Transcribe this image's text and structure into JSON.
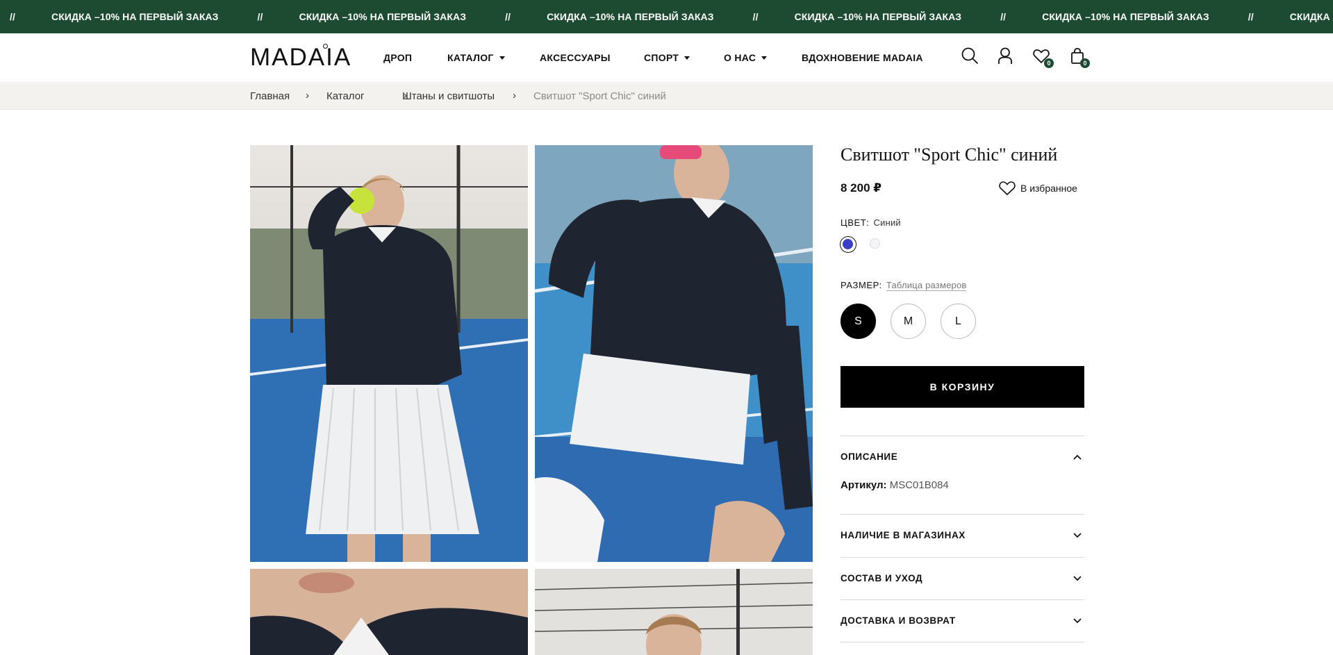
{
  "promo": {
    "separator": "//",
    "text": "СКИДКА –10% НА ПЕРВЫЙ ЗАКАЗ",
    "repeat_count": 6
  },
  "header": {
    "logo": "MADAIA",
    "nav": [
      {
        "label": "ДРОП",
        "has_dropdown": false
      },
      {
        "label": "КАТАЛОГ",
        "has_dropdown": true
      },
      {
        "label": "АКСЕССУАРЫ",
        "has_dropdown": false
      },
      {
        "label": "СПОРТ",
        "has_dropdown": true
      },
      {
        "label": "О НАС",
        "has_dropdown": true
      },
      {
        "label": "ВДОХНОВЕНИЕ MADAIA",
        "has_dropdown": false
      }
    ],
    "icons": [
      "search-icon",
      "user-icon",
      "heart-icon",
      "bag-icon"
    ],
    "favorites_count": "0",
    "cart_count": "0"
  },
  "breadcrumbs": [
    {
      "label": "Главная"
    },
    {
      "label": "Каталог"
    },
    {
      "label": "Штаны и свитшоты"
    },
    {
      "label": "Свитшот \"Sport Chic\" синий"
    }
  ],
  "product": {
    "title": "Свитшот \"Sport Chic\" синий",
    "price": "8 200 ₽",
    "favorite_label": "В избранное",
    "color_label": "ЦВЕТ:",
    "color_value": "Синий",
    "colors": [
      {
        "name": "Синий",
        "hex": "#3a3fc6",
        "selected": true
      },
      {
        "name": "Белый",
        "hex": "#f3f4f7",
        "selected": false
      }
    ],
    "size_label": "РАЗМЕР:",
    "size_chart_link": "Таблица размеров",
    "sizes": [
      {
        "label": "S",
        "selected": true
      },
      {
        "label": "M",
        "selected": false
      },
      {
        "label": "L",
        "selected": false
      }
    ],
    "add_to_cart": "В КОРЗИНУ",
    "accordion": [
      {
        "title": "ОПИСАНИЕ",
        "expanded": true
      },
      {
        "title": "НАЛИЧИЕ В МАГАЗИНАХ",
        "expanded": false
      },
      {
        "title": "СОСТАВ И УХОД",
        "expanded": false
      },
      {
        "title": "ДОСТАВКА И ВОЗВРАТ",
        "expanded": false
      }
    ],
    "sku_label": "Артикул:",
    "sku_value": "MSC01B084"
  },
  "colors": {
    "promo_bg": "#1d4b32",
    "breadcrumb_bg": "#f4f2ef",
    "button_bg": "#000000"
  }
}
